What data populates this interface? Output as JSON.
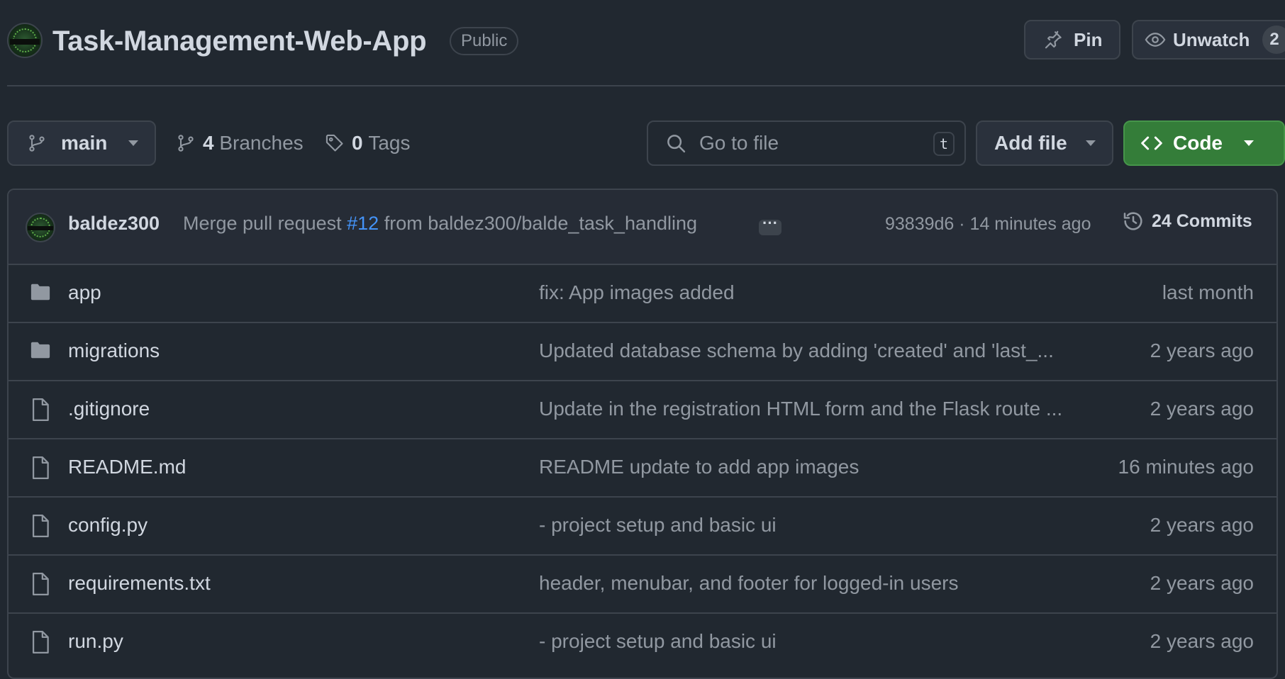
{
  "header": {
    "repo_name": "Task-Management-Web-App",
    "visibility": "Public",
    "pin_label": "Pin",
    "unwatch_label": "Unwatch",
    "watch_count": "2"
  },
  "toolbar": {
    "branch": "main",
    "branches_count": "4",
    "branches_label": "Branches",
    "tags_count": "0",
    "tags_label": "Tags",
    "search_placeholder": "Go to file",
    "search_shortcut": "t",
    "add_file_label": "Add file",
    "code_label": "Code"
  },
  "latest_commit": {
    "author": "baldez300",
    "message_prefix": "Merge pull request",
    "pr_number": "#12",
    "message_suffix": "from baldez300/balde_task_handling",
    "hash_time": "93839d6 · 14 minutes ago",
    "commits_label": "24 Commits"
  },
  "files": [
    {
      "type": "folder",
      "name": "app",
      "message": "fix: App images added",
      "time": "last month"
    },
    {
      "type": "folder",
      "name": "migrations",
      "message": "Updated database schema by adding 'created' and 'last_...",
      "time": "2 years ago"
    },
    {
      "type": "file",
      "name": ".gitignore",
      "message": "Update in the registration HTML form and the Flask route ...",
      "time": "2 years ago"
    },
    {
      "type": "file",
      "name": "README.md",
      "message": "README update to add app images",
      "time": "16 minutes ago"
    },
    {
      "type": "file",
      "name": "config.py",
      "message": "- project setup and basic ui",
      "time": "2 years ago"
    },
    {
      "type": "file",
      "name": "requirements.txt",
      "message": "header, menubar, and footer for logged-in users",
      "time": "2 years ago"
    },
    {
      "type": "file",
      "name": "run.py",
      "message": "- project setup and basic ui",
      "time": "2 years ago"
    }
  ],
  "colors": {
    "background": "#212830",
    "border": "#3d444d",
    "text": "#d1d7e0",
    "muted": "#9198a1",
    "link": "#4493f8",
    "code_button": "#347d39"
  }
}
